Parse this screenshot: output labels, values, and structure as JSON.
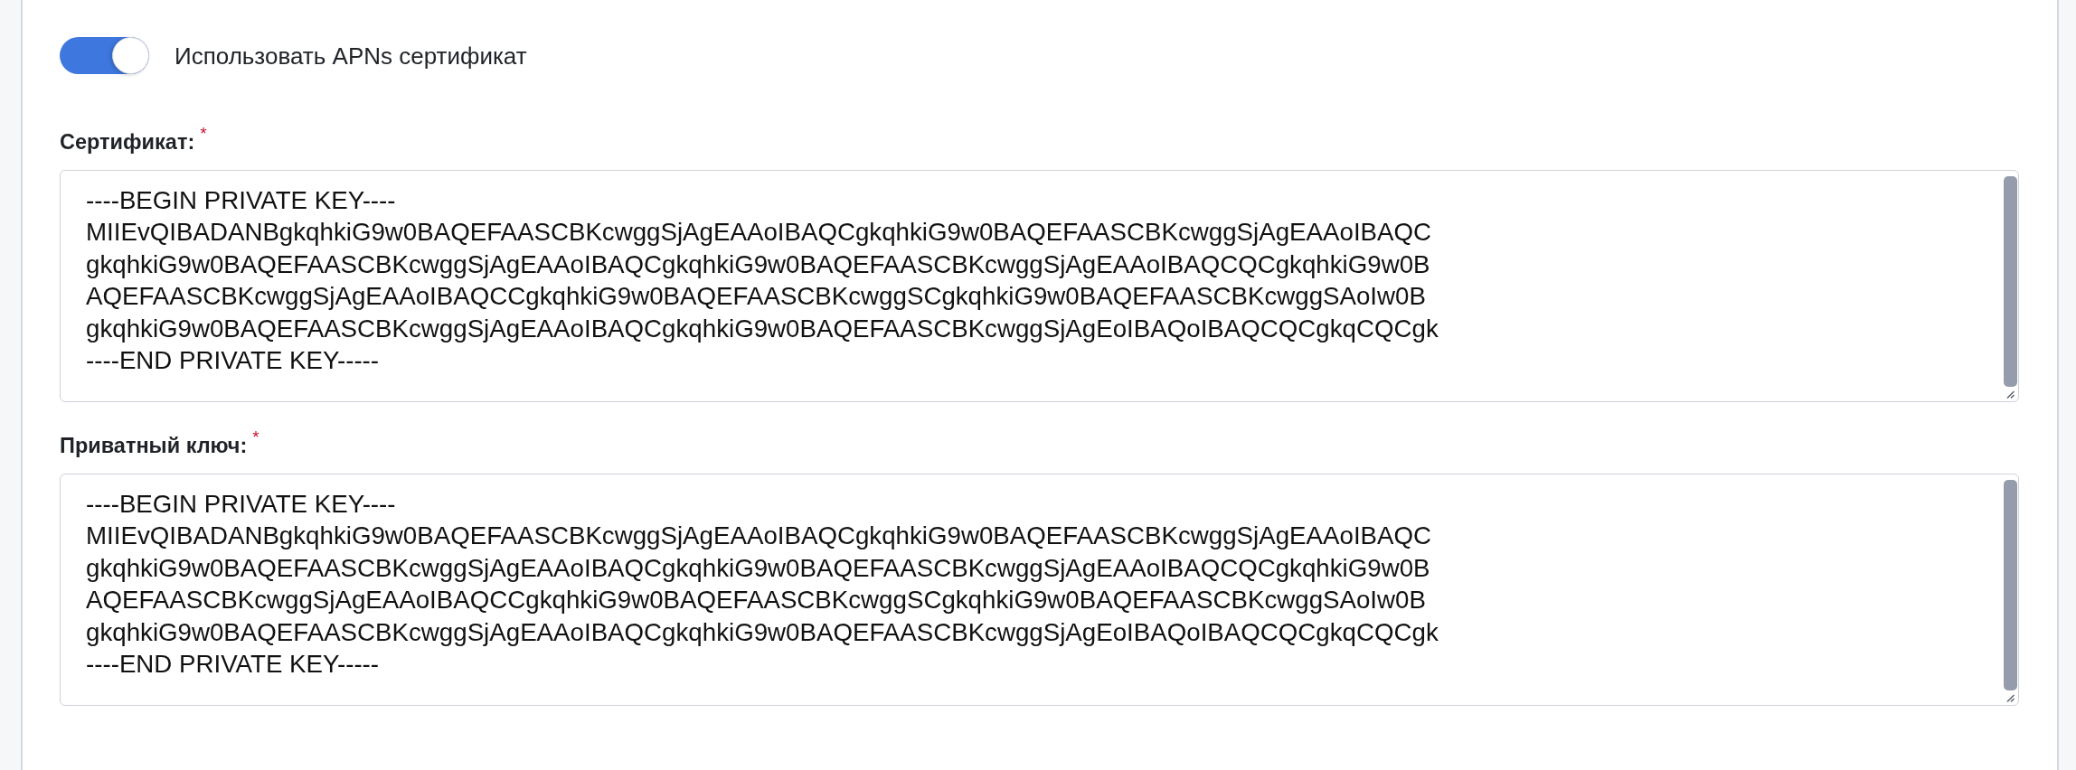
{
  "toggle": {
    "label": "Использовать APNs сертификат",
    "on": true
  },
  "fields": [
    {
      "label": "Сертификат:",
      "required_mark": "*",
      "value": "----BEGIN PRIVATE KEY----\nMIIEvQIBADANBgkqhkiG9w0BAQEFAASCBKcwggSjAgEAAoIBAQCgkqhkiG9w0BAQEFAASCBKcwggSjAgEAAoIBAQC\ngkqhkiG9w0BAQEFAASCBKcwggSjAgEAAoIBAQCgkqhkiG9w0BAQEFAASCBKcwggSjAgEAAoIBAQCQCgkqhkiG9w0B\nAQEFAASCBKcwggSjAgEAAoIBAQCCgkqhkiG9w0BAQEFAASCBKcwggSCgkqhkiG9w0BAQEFAASCBKcwggSAoIw0B\ngkqhkiG9w0BAQEFAASCBKcwggSjAgEAAoIBAQCgkqhkiG9w0BAQEFAASCBKcwggSjAgEoIBAQoIBAQCQCgkqCQCgk\n----END PRIVATE KEY-----"
    },
    {
      "label": "Приватный ключ:",
      "required_mark": "*",
      "value": "----BEGIN PRIVATE KEY----\nMIIEvQIBADANBgkqhkiG9w0BAQEFAASCBKcwggSjAgEAAoIBAQCgkqhkiG9w0BAQEFAASCBKcwggSjAgEAAoIBAQC\ngkqhkiG9w0BAQEFAASCBKcwggSjAgEAAoIBAQCgkqhkiG9w0BAQEFAASCBKcwggSjAgEAAoIBAQCQCgkqhkiG9w0B\nAQEFAASCBKcwggSjAgEAAoIBAQCCgkqhkiG9w0BAQEFAASCBKcwggSCgkqhkiG9w0BAQEFAASCBKcwggSAoIw0B\ngkqhkiG9w0BAQEFAASCBKcwggSjAgEAAoIBAQCgkqhkiG9w0BAQEFAASCBKcwggSjAgEoIBAQoIBAQCQCgkqCQCgk\n----END PRIVATE KEY-----"
    }
  ]
}
